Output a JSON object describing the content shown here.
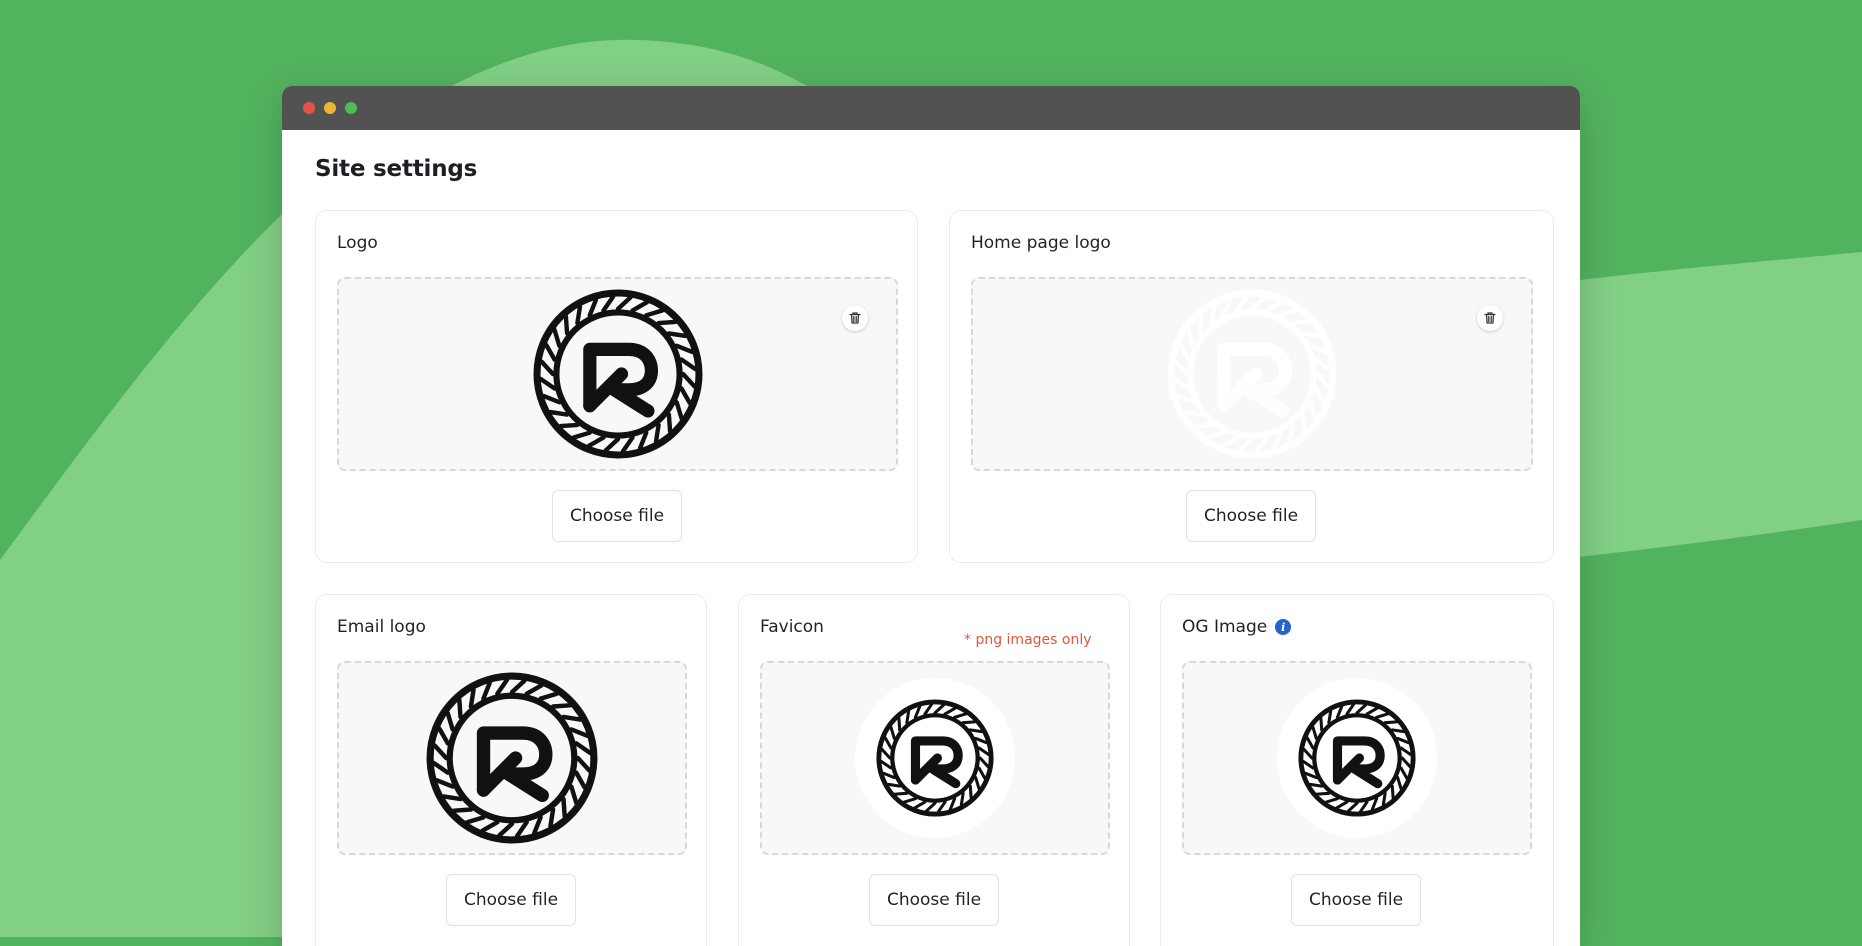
{
  "window": {
    "controls": {
      "close_color": "#e4534a",
      "minimize_color": "#e9b53a",
      "maximize_color": "#4fbd56"
    }
  },
  "page": {
    "title": "Site settings"
  },
  "colors": {
    "background": "#52b35f",
    "swoosh": "#82cf86",
    "note": "#e0593b",
    "info": "#2563c9"
  },
  "cards": {
    "logo": {
      "title": "Logo",
      "button": "Choose file",
      "icon": "logo-image"
    },
    "home_page_logo": {
      "title": "Home page logo",
      "button": "Choose file",
      "icon": "logo-image-faded"
    },
    "email_logo": {
      "title": "Email logo",
      "button": "Choose file"
    },
    "favicon": {
      "title": "Favicon",
      "note": "* png images only",
      "button": "Choose file"
    },
    "og_image": {
      "title": "OG Image",
      "info_icon": "info-icon",
      "button": "Choose file"
    }
  }
}
